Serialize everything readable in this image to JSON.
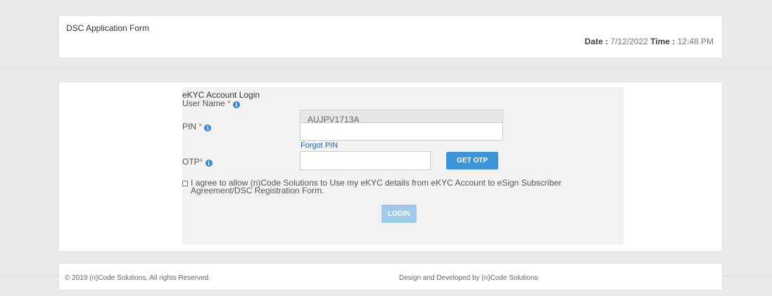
{
  "header": {
    "title": "DSC Application Form",
    "date_label": "Date :",
    "date_value": "7/12/2022",
    "time_label": "Time :",
    "time_value": "12:48 PM"
  },
  "login": {
    "section_title": "eKYC Account Login",
    "username_label": "User Name",
    "username_value": "AUJPV1713A",
    "pin_label": "PIN",
    "pin_value": "",
    "forgot_pin": "Forgot PIN",
    "otp_label": "OTP",
    "otp_value": "",
    "get_otp_button": "GET OTP",
    "agree_text": "I agree to allow (n)Code Solutions to Use my eKYC details from eKYC Account to eSign Subscriber Agreement/DSC Registration Form.",
    "login_button": "LOGIN",
    "required_mark": "*",
    "info_glyph": "i"
  },
  "footer": {
    "copyright": "© 2019 (n)Code Solutions, All rights Reserved.",
    "credit": "Design and Developed by (n)Code Solutions"
  },
  "colors": {
    "accent": "#3d94d6",
    "login_button": "#9fcbe8",
    "link": "#2a6aa8"
  }
}
